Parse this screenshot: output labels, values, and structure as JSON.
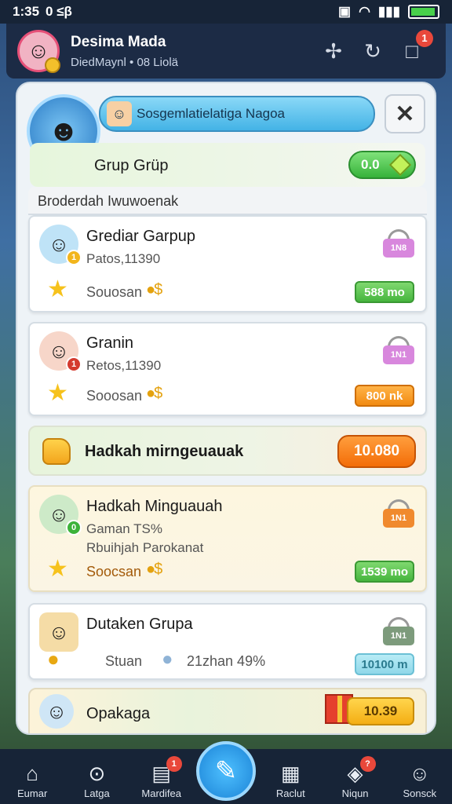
{
  "status_bar": {
    "time": "1:35",
    "extra": "0 ≤β"
  },
  "profile": {
    "name": "Desima Mada",
    "subtitle": "DiedMaynl  •  08 Liolä",
    "notifications": "1"
  },
  "group": {
    "title": "Sosgemlatielatiga Nagoa",
    "name": "Grup Grüp",
    "pill_value": "0.0"
  },
  "list_header": "Broderdah Iwuwoenak",
  "cards": [
    {
      "title": "Grediar Garpup",
      "sub": "Patos,11390",
      "row_label": "Souosan",
      "lock_label": "1N8",
      "price": "588 mo",
      "badge": "1"
    },
    {
      "title": "Granin",
      "sub": "Retos,11390",
      "row_label": "Sooosan",
      "lock_label": "1N1",
      "price": "800 nk",
      "badge": "1"
    },
    {
      "title": "Hadkah Minguauah",
      "sub": "Gaman TS%",
      "sub2": "Rbuihjah Parokanat",
      "row_label": "Soocsan",
      "lock_label": "1N1",
      "price": "1539 mo",
      "badge": "0"
    },
    {
      "title": "Dutaken Grupa",
      "row_label": "Stuan",
      "sub": "21zhan 49%",
      "lock_label": "1N1",
      "price": "10100 m"
    }
  ],
  "hand_row": {
    "label": "Hadkah mirngeuauak",
    "value": "10.080"
  },
  "bottom_strip": {
    "label": "Opakaga",
    "value": "10.39"
  },
  "nav": [
    {
      "label": "Eumar"
    },
    {
      "label": "Latga"
    },
    {
      "label": "Mardifea",
      "badge": "1"
    },
    {
      "label": "Raclut"
    },
    {
      "label": "Niqun",
      "badge": "?"
    },
    {
      "label": "Sonsck"
    }
  ]
}
